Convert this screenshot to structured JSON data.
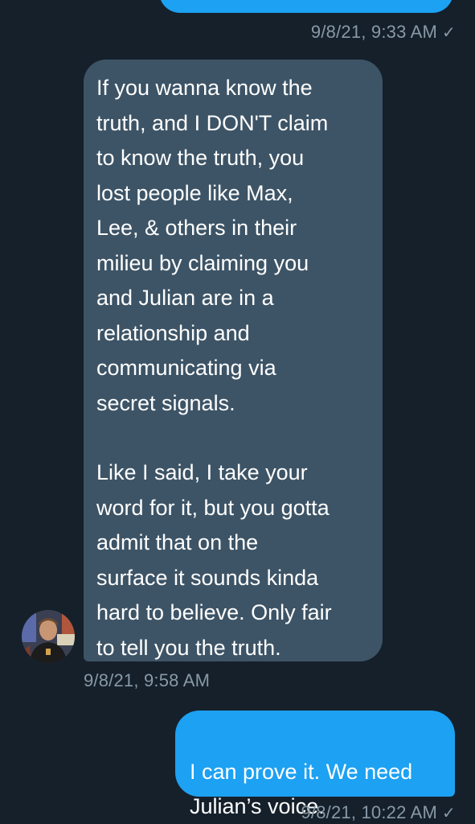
{
  "conversation": {
    "top_timestamp": "9/8/21, 9:33 AM",
    "top_status_icon": "check-icon",
    "received": {
      "paragraph_1": "If you wanna know the\ntruth, and I DON'T claim\nto know the truth, you\nlost people like Max,\nLee, & others in their\nmilieu by claiming you\nand Julian are in a\nrelationship and\ncommunicating via\nsecret signals.",
      "paragraph_2": "Like I said, I take your\nword for it, but you gotta\nadmit that on the\nsurface it sounds kinda\nhard to believe. Only fair\nto tell you the truth.",
      "timestamp": "9/8/21, 9:58 AM"
    },
    "sent": {
      "text": "I can prove it. We need\nJulian’s voice.",
      "timestamp": "9/8/21, 10:22 AM",
      "status_icon": "check-icon"
    }
  },
  "colors": {
    "background": "#15202b",
    "received_bubble": "#3d5466",
    "sent_bubble": "#1da1f2",
    "meta_text": "#8899a6"
  }
}
